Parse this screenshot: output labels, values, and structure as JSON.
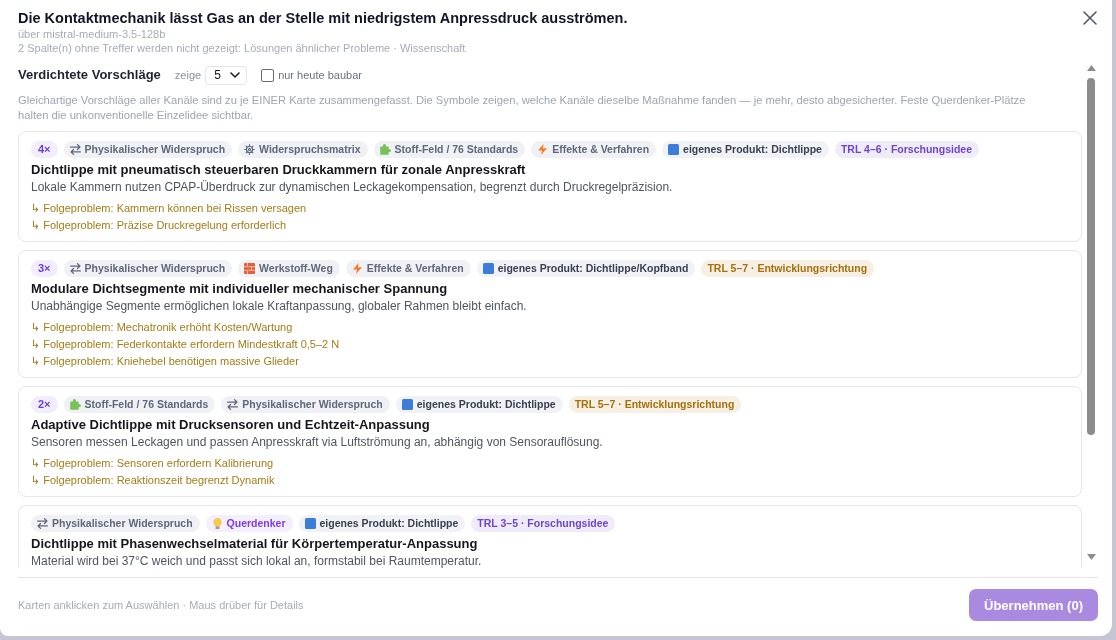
{
  "dialog": {
    "title": "Die Kontaktmechanik lässt Gas an der Stelle mit niedrigstem Anpressdruck ausströmen.",
    "model": "über mistral-medium-3.5-128b",
    "note": "2 Spalte(n) ohne Treffer werden nicht gezeigt: Lösungen ähnlicher Probleme · Wissenschaft"
  },
  "toolbar": {
    "heading": "Verdichtete Vorschläge",
    "show_count": {
      "label": "zeige",
      "value": "5"
    },
    "buildable_filter": {
      "label": "nur heute baubar",
      "checked": false
    }
  },
  "description": "Gleichartige Vorschläge aller Kanäle sind zu je EINER Karte zusammengefasst. Die Symbole zeigen, welche Kanäle dieselbe Maßnahme fanden — je mehr, desto abgesicherter. Feste Querdenker-Plätze halten die unkonventionelle Einzelidee sichtbar.",
  "cards": [
    {
      "selected": false,
      "count": "4×",
      "tags": [
        {
          "kind": "contradiction",
          "label": "Physikalischer Widerspruch"
        },
        {
          "kind": "matrix",
          "label": "Widerspruchsmatrix"
        },
        {
          "kind": "substance",
          "label": "Stoff-Feld / 76 Standards"
        },
        {
          "kind": "effects",
          "label": "Effekte & Verfahren"
        },
        {
          "kind": "product",
          "label": "eigenes Produkt: Dichtlippe"
        },
        {
          "kind": "trl",
          "label": "TRL 4–6 · Forschungsidee",
          "color": "#6e46c8"
        }
      ],
      "title": "Dichtlippe mit pneumatisch steuerbaren Druckkammern für zonale Anpresskraft",
      "description": "Lokale Kammern nutzen CPAP-Überdruck zur dynamischen Leckagekompensation, begrenzt durch Druckregelpräzision.",
      "follow_ups": [
        "↳ Folgeproblem: Kammern können bei Rissen versagen",
        "↳ Folgeproblem: Präzise Druckregelung erforderlich"
      ]
    },
    {
      "selected": false,
      "count": "3×",
      "tags": [
        {
          "kind": "contradiction",
          "label": "Physikalischer Widerspruch"
        },
        {
          "kind": "material",
          "label": "Werkstoff-Weg"
        },
        {
          "kind": "effects",
          "label": "Effekte & Verfahren"
        },
        {
          "kind": "product",
          "label": "eigenes Produkt: Dichtlippe/Kopfband"
        },
        {
          "kind": "trl",
          "label": "TRL 5–7 · Entwicklungsrichtung",
          "color": "#a6700a"
        }
      ],
      "title": "Modulare Dichtsegmente mit individueller mechanischer Spannung",
      "description": "Unabhängige Segmente ermöglichen lokale Kraftanpassung, globaler Rahmen bleibt einfach.",
      "follow_ups": [
        "↳ Folgeproblem: Mechatronik erhöht Kosten/Wartung",
        "↳ Folgeproblem: Federkontakte erfordern Mindestkraft 0,5–2 N",
        "↳ Folgeproblem: Kniehebel benötigen massive Glieder"
      ]
    },
    {
      "selected": false,
      "count": "2×",
      "tags": [
        {
          "kind": "substance",
          "label": "Stoff-Feld / 76 Standards"
        },
        {
          "kind": "contradiction",
          "label": "Physikalischer Widerspruch"
        },
        {
          "kind": "product",
          "label": "eigenes Produkt: Dichtlippe"
        },
        {
          "kind": "trl",
          "label": "TRL 5–7 · Entwicklungsrichtung",
          "color": "#a6700a"
        }
      ],
      "title": "Adaptive Dichtlippe mit Drucksensoren und Echtzeit-Anpassung",
      "description": "Sensoren messen Leckagen und passen Anpresskraft via Luftströmung an, abhängig von Sensorauflösung.",
      "follow_ups": [
        "↳ Folgeproblem: Sensoren erfordern Kalibrierung",
        "↳ Folgeproblem: Reaktionszeit begrenzt Dynamik"
      ]
    },
    {
      "selected": false,
      "tags": [
        {
          "kind": "contradiction",
          "label": "Physikalischer Widerspruch"
        },
        {
          "kind": "lateral",
          "label": "Querdenker"
        },
        {
          "kind": "product",
          "label": "eigenes Produkt: Dichtlippe"
        },
        {
          "kind": "trl",
          "label": "TRL 3–5 · Forschungsidee",
          "color": "#6e46c8"
        }
      ],
      "title": "Dichtlippe mit Phasenwechselmaterial für Körpertemperatur-Anpassung",
      "description": "Material wird bei 37°C weich und passt sich lokal an, formstabil bei Raumtemperatur."
    }
  ],
  "footer": {
    "hint": "Karten anklicken zum Auswählen · Maus drüber für Details",
    "apply_button": {
      "label": "Übernehmen (0)",
      "disabled": true
    }
  }
}
